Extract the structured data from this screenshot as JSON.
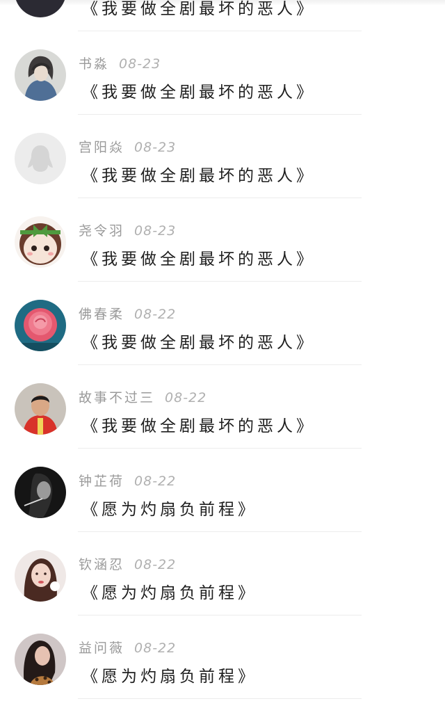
{
  "partial_top": {
    "content": "《我要做全剧最坏的恶人》"
  },
  "comments": [
    {
      "name": "书淼",
      "date": "08-23",
      "content": "《我要做全剧最坏的恶人》",
      "avatar": "illustrated-girl-avatar"
    },
    {
      "name": "宫阳焱",
      "date": "08-23",
      "content": "《我要做全剧最坏的恶人》",
      "avatar": "default-penguin-avatar"
    },
    {
      "name": "尧令羽",
      "date": "08-23",
      "content": "《我要做全剧最坏的恶人》",
      "avatar": "cartoon-doll-avatar"
    },
    {
      "name": "佛春柔",
      "date": "08-22",
      "content": "《我要做全剧最坏的恶人》",
      "avatar": "pink-rose-avatar"
    },
    {
      "name": "故事不过三",
      "date": "08-22",
      "content": "《我要做全剧最坏的恶人》",
      "avatar": "athlete-photo-avatar"
    },
    {
      "name": "钟芷荷",
      "date": "08-22",
      "content": "《愿为灼扇负前程》",
      "avatar": "monochrome-portrait-avatar"
    },
    {
      "name": "钦涵忍",
      "date": "08-22",
      "content": "《愿为灼扇负前程》",
      "avatar": "girl-portrait-avatar"
    },
    {
      "name": "益问薇",
      "date": "08-22",
      "content": "《愿为灼扇负前程》",
      "avatar": "woman-leopard-avatar"
    }
  ]
}
